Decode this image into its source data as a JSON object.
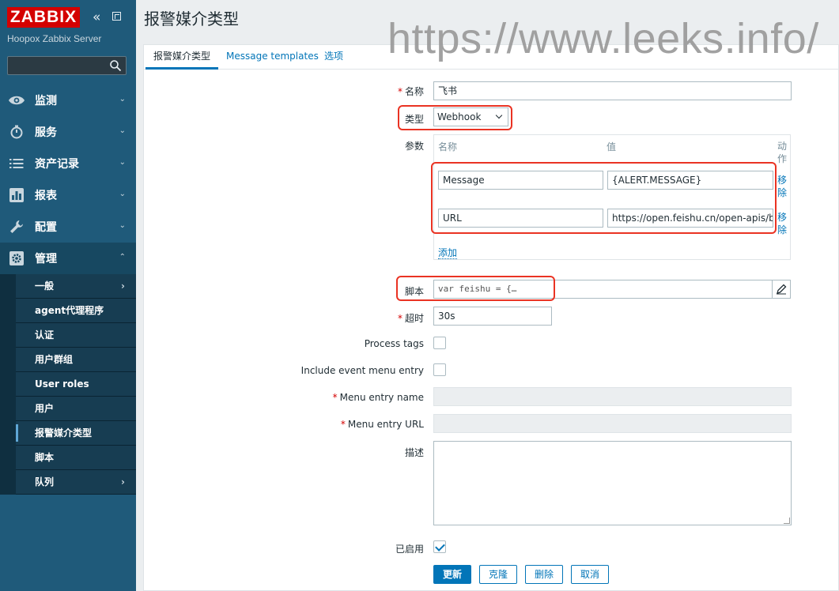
{
  "sidebar": {
    "logo": "ZABBIX",
    "server_name": "Hoopox Zabbix Server",
    "search": {
      "placeholder": "",
      "value": ""
    },
    "menu": [
      {
        "label": "监测",
        "icon": "eye-icon"
      },
      {
        "label": "服务",
        "icon": "clock-icon"
      },
      {
        "label": "资产记录",
        "icon": "list-icon"
      },
      {
        "label": "报表",
        "icon": "bar-chart-icon"
      },
      {
        "label": "配置",
        "icon": "wrench-icon"
      },
      {
        "label": "管理",
        "icon": "gear-icon"
      }
    ],
    "submenu": [
      "一般",
      "agent代理程序",
      "认证",
      "用户群组",
      "User roles",
      "用户",
      "报警媒介类型",
      "脚本",
      "队列"
    ]
  },
  "page": {
    "title": "报警媒介类型",
    "watermark": "https://www.leeks.info/"
  },
  "tabs": [
    "报警媒介类型",
    "Message templates",
    "选项"
  ],
  "form": {
    "name_label": "名称",
    "name_value": "飞书",
    "type_label": "类型",
    "type_value": "Webhook",
    "params_label": "参数",
    "params_headers": {
      "name": "名称",
      "value": "值",
      "action": "动作"
    },
    "params": [
      {
        "name": "Message",
        "value": "{ALERT.MESSAGE}",
        "action": "移除"
      },
      {
        "name": "URL",
        "value": "https://open.feishu.cn/open-apis/bot/v",
        "action": "移除"
      }
    ],
    "add_label": "添加",
    "script_label": "脚本",
    "script_value": "var feishu = {…",
    "timeout_label": "超时",
    "timeout_value": "30s",
    "process_tags_label": "Process tags",
    "process_tags_checked": false,
    "include_event_label": "Include event menu entry",
    "include_event_checked": false,
    "menu_entry_name_label": "Menu entry name",
    "menu_entry_url_label": "Menu entry URL",
    "description_label": "描述",
    "enabled_label": "已启用",
    "enabled_checked": true
  },
  "buttons": {
    "update": "更新",
    "clone": "克隆",
    "delete": "删除",
    "cancel": "取消"
  },
  "colors": {
    "sidebar": "#1f5a7a",
    "accent": "#0275b8",
    "logo": "#d40000",
    "highlight": "#ea3323"
  }
}
